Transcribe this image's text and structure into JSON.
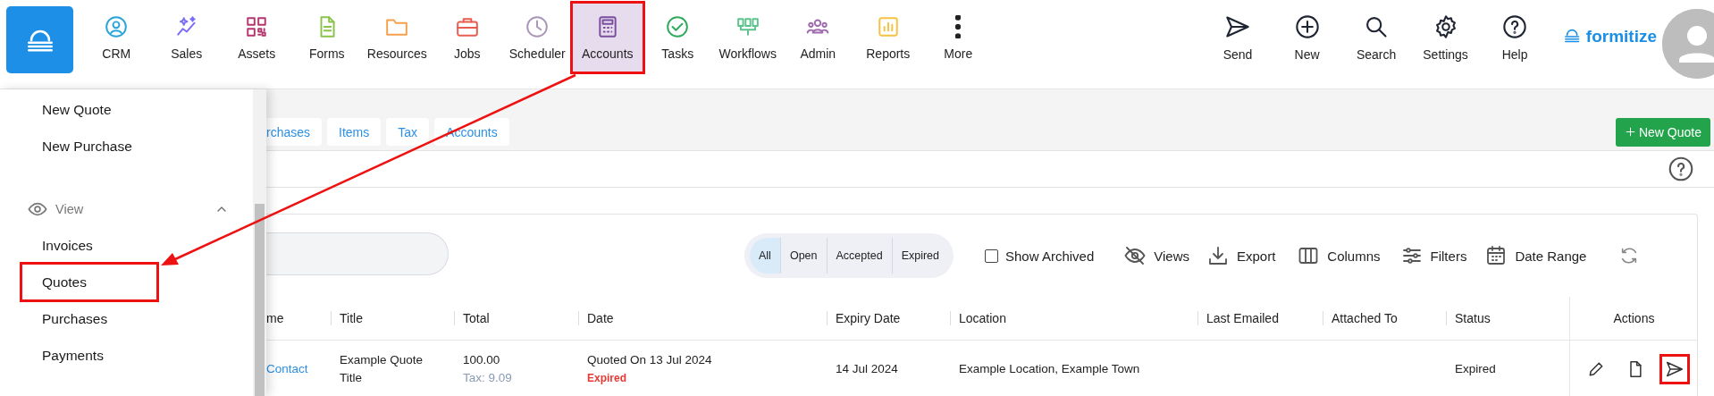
{
  "nav": {
    "items": [
      {
        "label": "CRM",
        "selected": false,
        "highlighted": false
      },
      {
        "label": "Sales",
        "selected": false,
        "highlighted": false
      },
      {
        "label": "Assets",
        "selected": false,
        "highlighted": false
      },
      {
        "label": "Forms",
        "selected": false,
        "highlighted": false
      },
      {
        "label": "Resources",
        "selected": false,
        "highlighted": false
      },
      {
        "label": "Jobs",
        "selected": false,
        "highlighted": false
      },
      {
        "label": "Scheduler",
        "selected": false,
        "highlighted": false
      },
      {
        "label": "Accounts",
        "selected": true,
        "highlighted": true
      },
      {
        "label": "Tasks",
        "selected": false,
        "highlighted": false
      },
      {
        "label": "Workflows",
        "selected": false,
        "highlighted": false
      },
      {
        "label": "Admin",
        "selected": false,
        "highlighted": false
      },
      {
        "label": "Reports",
        "selected": false,
        "highlighted": false
      },
      {
        "label": "More",
        "selected": false,
        "highlighted": false
      }
    ]
  },
  "actions": [
    {
      "label": "Send"
    },
    {
      "label": "New"
    },
    {
      "label": "Search"
    },
    {
      "label": "Settings"
    },
    {
      "label": "Help"
    }
  ],
  "brand": "formitize",
  "side_menu": {
    "create_items": [
      "New Quote",
      "New Purchase"
    ],
    "view_section": {
      "label": "View",
      "expanded": true,
      "items": [
        {
          "label": "Invoices",
          "highlighted": false
        },
        {
          "label": "Quotes",
          "highlighted": true
        },
        {
          "label": "Purchases",
          "highlighted": false
        },
        {
          "label": "Payments",
          "highlighted": false
        }
      ]
    }
  },
  "tabs": [
    {
      "label": "rchases"
    },
    {
      "label": "Items"
    },
    {
      "label": "Tax"
    },
    {
      "label": "Accounts"
    }
  ],
  "new_quote_button": "New Quote",
  "toolbar": {
    "segments": [
      {
        "label": "All",
        "selected": true
      },
      {
        "label": "Open",
        "selected": false
      },
      {
        "label": "Accepted",
        "selected": false
      },
      {
        "label": "Expired",
        "selected": false
      }
    ],
    "show_archived": {
      "label": "Show Archived",
      "checked": false
    },
    "tools": [
      "Views",
      "Export",
      "Columns",
      "Filters",
      "Date Range"
    ]
  },
  "table": {
    "columns": [
      "me",
      "Title",
      "Total",
      "Date",
      "Expiry Date",
      "Location",
      "Last Emailed",
      "Attached To",
      "Status",
      "Actions"
    ],
    "rows": [
      {
        "name": "Contact",
        "title": "Example Quote Title",
        "total": "100.00",
        "tax": "Tax: 9.09",
        "date": "Quoted On 13 Jul 2024",
        "date_status": "Expired",
        "expiry_date": "14 Jul 2024",
        "location": "Example Location, Example Town",
        "status": "Expired",
        "actions": [
          {
            "highlighted": false
          },
          {
            "highlighted": false
          },
          {
            "highlighted": true
          }
        ]
      }
    ]
  },
  "annotations": {
    "arrow": true
  }
}
